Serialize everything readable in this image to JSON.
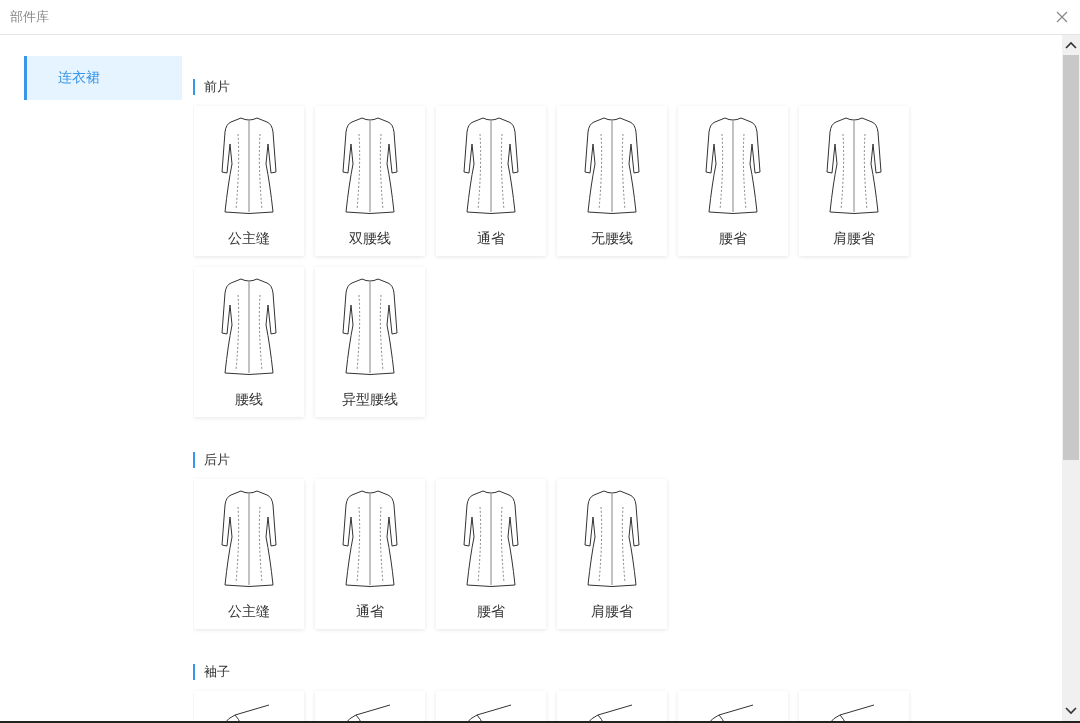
{
  "window": {
    "title": "部件库"
  },
  "sidebar": {
    "items": [
      {
        "label": "连衣裙",
        "selected": true
      }
    ]
  },
  "sections": [
    {
      "title": "前片",
      "items": [
        {
          "kind": "dress",
          "label": "公主缝"
        },
        {
          "kind": "dress",
          "label": "双腰线"
        },
        {
          "kind": "dress",
          "label": "通省"
        },
        {
          "kind": "dress",
          "label": "无腰线"
        },
        {
          "kind": "dress",
          "label": "腰省"
        },
        {
          "kind": "dress",
          "label": "肩腰省"
        },
        {
          "kind": "dress",
          "label": "腰线"
        },
        {
          "kind": "dress",
          "label": "异型腰线"
        }
      ]
    },
    {
      "title": "后片",
      "items": [
        {
          "kind": "dress",
          "label": "公主缝"
        },
        {
          "kind": "dress",
          "label": "通省"
        },
        {
          "kind": "dress",
          "label": "腰省"
        },
        {
          "kind": "dress",
          "label": "肩腰省"
        }
      ]
    },
    {
      "title": "袖子",
      "items": [
        {
          "kind": "sleeve"
        },
        {
          "kind": "sleeve"
        },
        {
          "kind": "sleeve"
        },
        {
          "kind": "sleeve"
        },
        {
          "kind": "sleeve"
        },
        {
          "kind": "sleeve"
        }
      ]
    }
  ]
}
